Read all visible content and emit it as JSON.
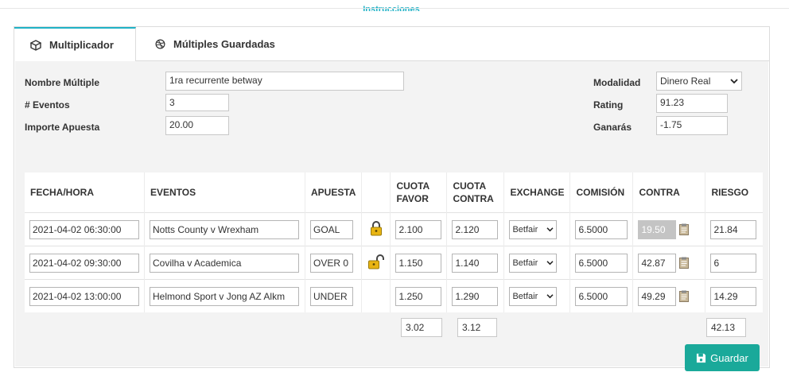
{
  "header": {
    "instructions_link": "Instrucciones"
  },
  "tabs": [
    {
      "label": "Multiplicador",
      "icon": "cube-icon",
      "active": true
    },
    {
      "label": "Múltiples Guardadas",
      "icon": "dribbble-ball-icon",
      "active": false
    }
  ],
  "form": {
    "nombre_label": "Nombre Múltiple",
    "nombre_value": "1ra recurrente betway",
    "eventos_label": "# Eventos",
    "eventos_value": "3",
    "importe_label": "Importe Apuesta",
    "importe_value": "20.00",
    "modalidad_label": "Modalidad",
    "modalidad_value": "Dinero Real",
    "rating_label": "Rating",
    "rating_value": "91.23",
    "ganaras_label": "Ganarás",
    "ganaras_value": "-1.75"
  },
  "table": {
    "headers": {
      "fecha": "FECHA/HORA",
      "eventos": "EVENTOS",
      "apuesta": "APUESTA",
      "cuota_favor_1": "CUOTA",
      "cuota_favor_2": "FAVOR",
      "cuota_contra_1": "CUOTA",
      "cuota_contra_2": "CONTRA",
      "exchange": "EXCHANGE",
      "comision": "COMISIÓN",
      "contra": "CONTRA",
      "riesgo": "RIESGO"
    },
    "rows": [
      {
        "fecha": "2021-04-02 06:30:00",
        "evento": "Notts County v Wrexham",
        "apuesta": "GOAL",
        "lock": "locked",
        "cuota_favor": "2.100",
        "cuota_contra": "2.120",
        "exchange": "Betfair",
        "comision": "6.5000",
        "contra": "19.50",
        "riesgo": "21.84"
      },
      {
        "fecha": "2021-04-02 09:30:00",
        "evento": "Covilha v Academica",
        "apuesta": "OVER 0",
        "lock": "unlocked",
        "cuota_favor": "1.150",
        "cuota_contra": "1.140",
        "exchange": "Betfair",
        "comision": "6.5000",
        "contra": "42.87",
        "riesgo": "6"
      },
      {
        "fecha": "2021-04-02 13:00:00",
        "evento": "Helmond Sport v Jong AZ Alkm",
        "apuesta": "UNDER",
        "lock": "none",
        "cuota_favor": "1.250",
        "cuota_contra": "1.290",
        "exchange": "Betfair",
        "comision": "6.5000",
        "contra": "49.29",
        "riesgo": "14.29"
      }
    ],
    "totals": {
      "cuota_favor": "3.02",
      "cuota_contra": "3.12",
      "riesgo": "42.13"
    }
  },
  "actions": {
    "save_label": "Guardar",
    "save_icon": "floppy-disk-icon"
  },
  "colors": {
    "accent": "#20b2c6",
    "save_button": "#1aa99a",
    "lock_gold": "#e8b412"
  }
}
